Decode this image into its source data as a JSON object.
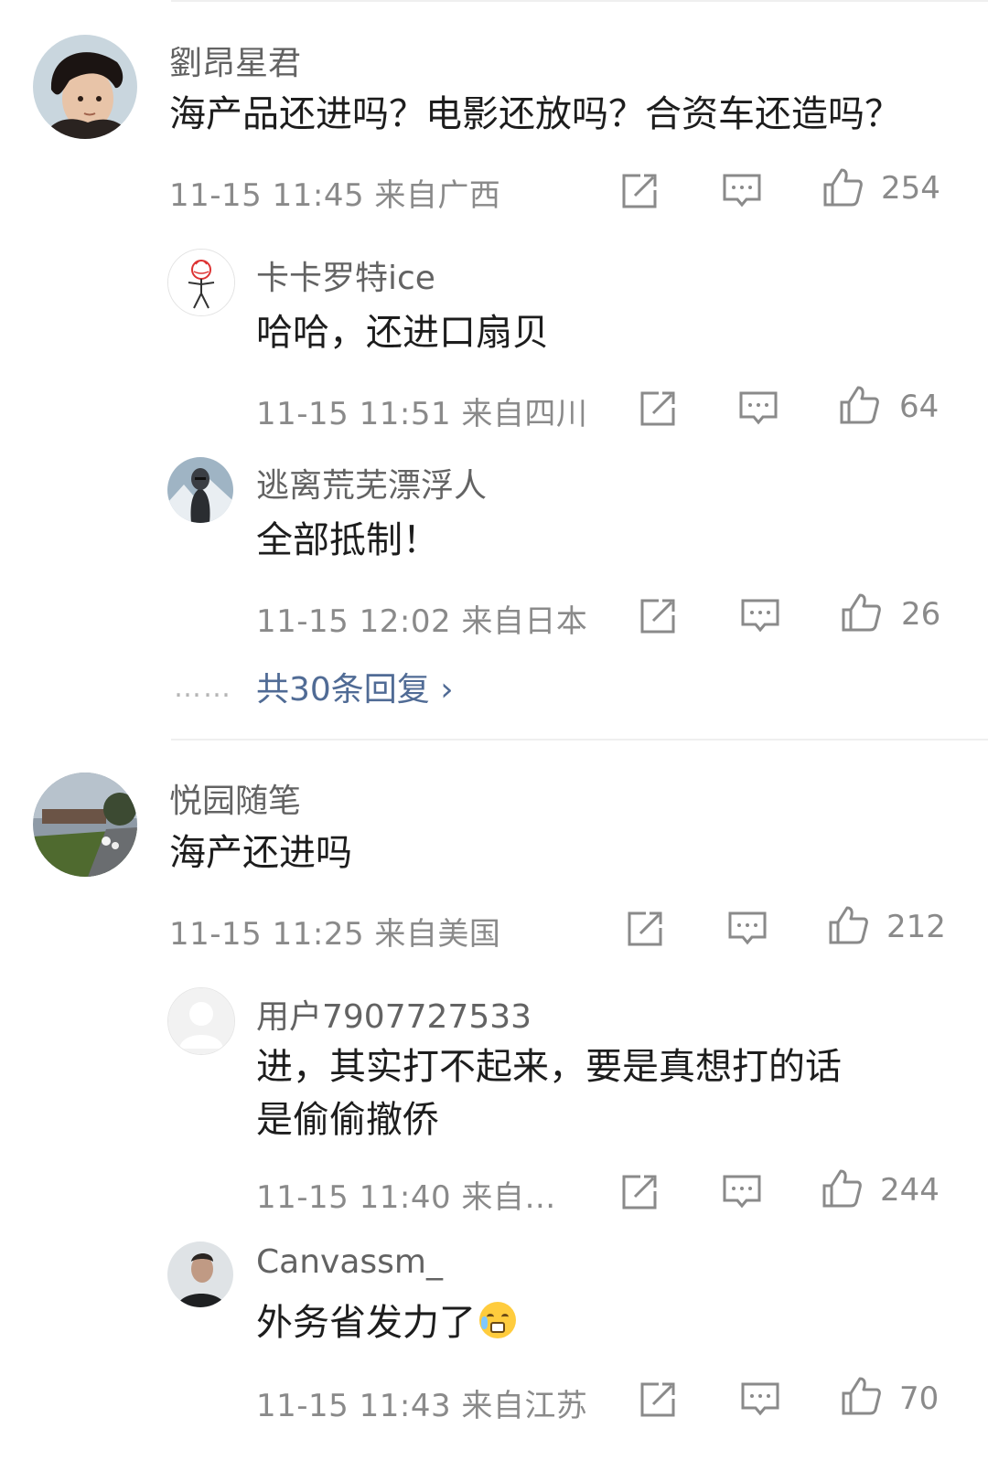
{
  "comments": [
    {
      "name": "劉昂星君",
      "text": "海产品还进吗？电影还放吗？合资车还造吗？",
      "meta": "11-15 11:45  来自广西",
      "likes": "254",
      "avatar": "man-portrait-avatar",
      "replies": [
        {
          "name": "卡卡罗特ice",
          "text": "哈哈，还进口扇贝",
          "meta": "11-15 11:51  来自四川",
          "likes": "64",
          "avatar": "stick-figure-avatar"
        },
        {
          "name": "逃离荒芜漂浮人",
          "text": "全部抵制！",
          "meta": "11-15 12:02  来自日本",
          "likes": "26",
          "avatar": "knight-armor-avatar"
        }
      ],
      "more_replies": "共30条回复 ›"
    },
    {
      "name": "悦园随笔",
      "text": "海产还进吗",
      "meta": "11-15 11:25  来自美国",
      "likes": "212",
      "avatar": "garden-photo-avatar",
      "replies": [
        {
          "name": "用户7907727533",
          "text": "进，其实打不起来，要是真想打的话",
          "text2": "是偷偷撤侨",
          "meta": "11-15 11:40  来自…",
          "likes": "244",
          "avatar": "default-user-avatar"
        },
        {
          "name": "Canvassm_",
          "text": "外务省发力了",
          "meta": "11-15 11:43  来自江苏",
          "likes": "70",
          "avatar": "man-photo-avatar",
          "emoji": "weary-face-emoji"
        }
      ]
    }
  ],
  "more_dots": "……",
  "colors": {
    "link": "#506b95",
    "meta": "#8a8a8a",
    "name": "#636363",
    "divider": "#efefef"
  }
}
